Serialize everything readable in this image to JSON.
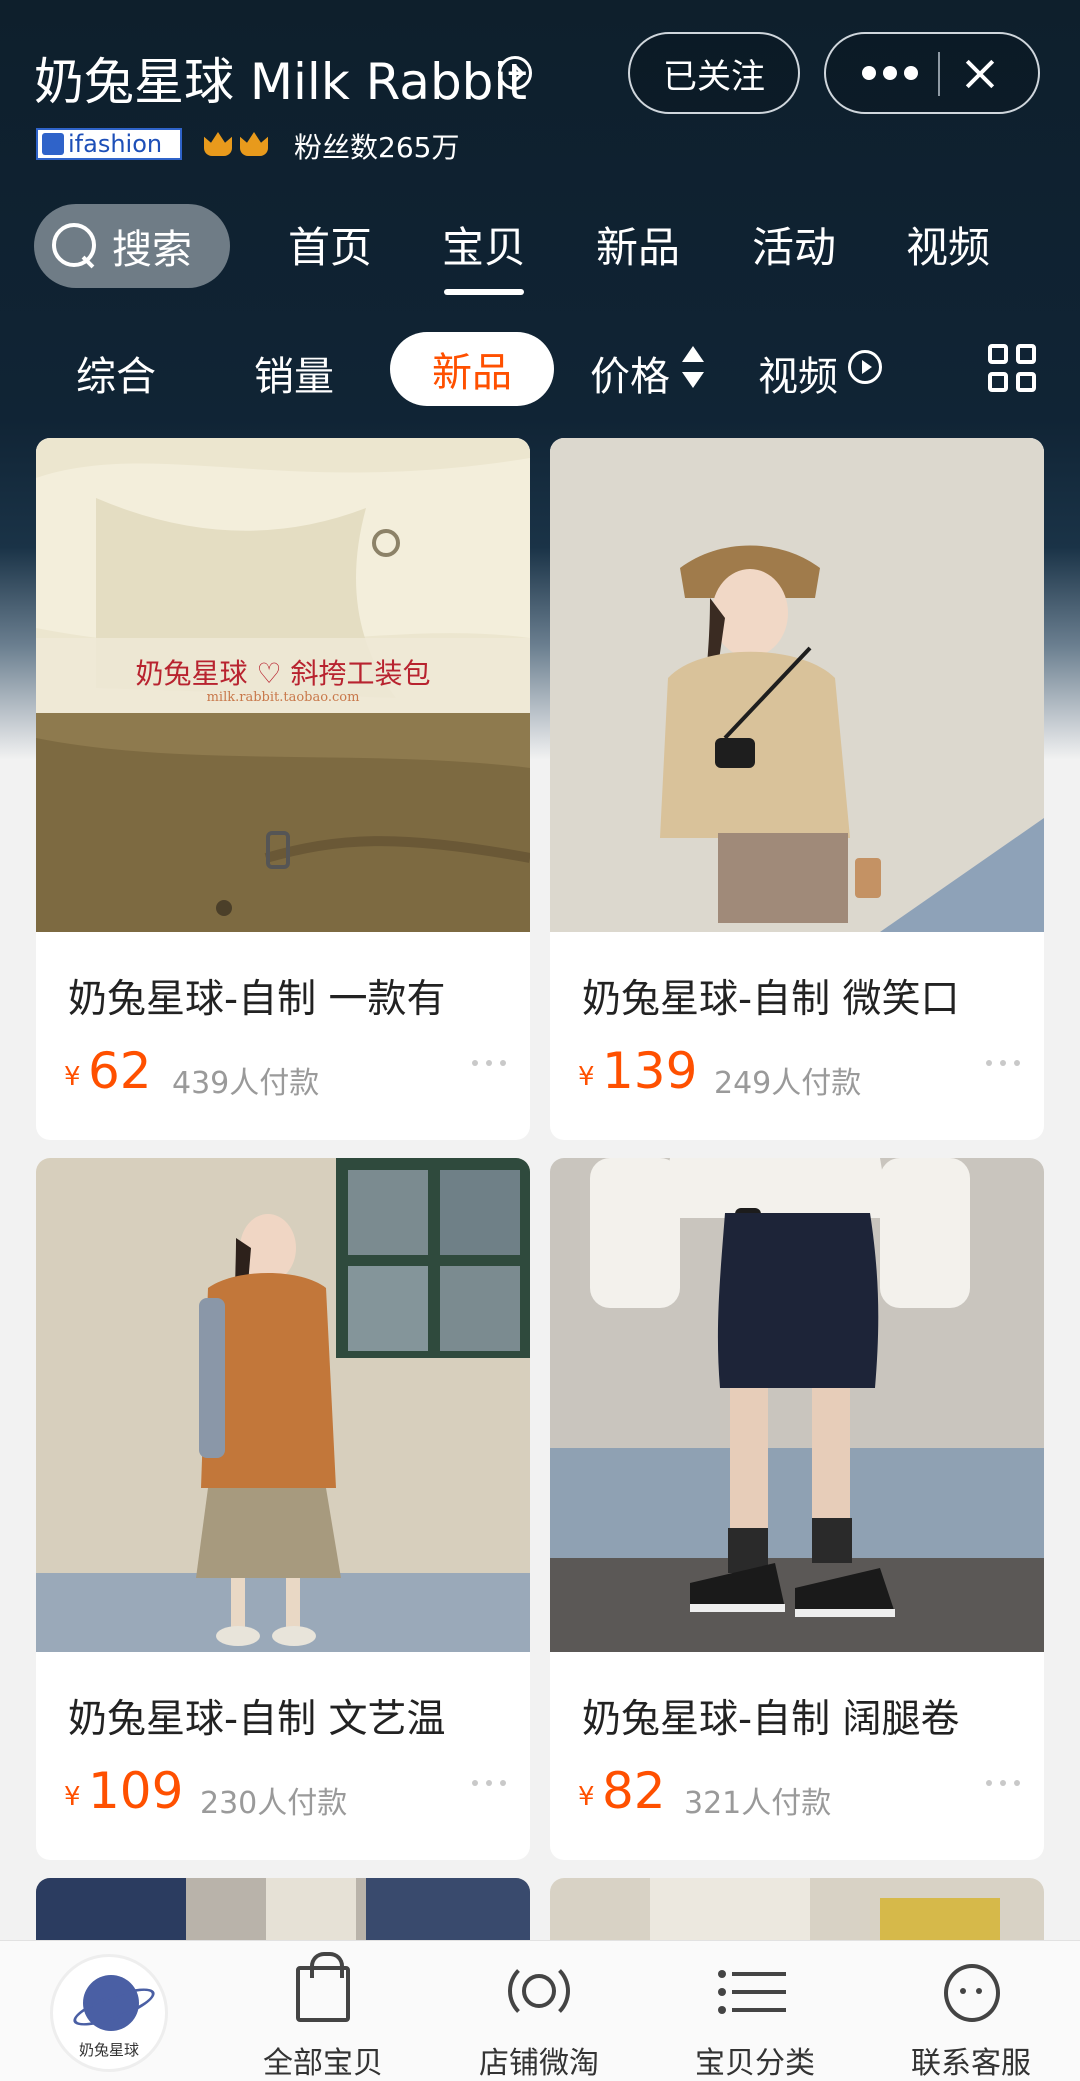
{
  "header": {
    "shop_name": "奶兔星球 Milk Rabbit",
    "follow_label": "已关注",
    "badge_text": "ifashion",
    "fans_text": "粉丝数265万"
  },
  "search": {
    "label": "搜索"
  },
  "tabs": [
    {
      "label": "首页",
      "active": false
    },
    {
      "label": "宝贝",
      "active": true
    },
    {
      "label": "新品",
      "active": false
    },
    {
      "label": "活动",
      "active": false
    },
    {
      "label": "视频",
      "active": false
    }
  ],
  "sort_bar": {
    "items": [
      "综合",
      "销量",
      "新品",
      "价格",
      "视频"
    ],
    "active": "新品"
  },
  "products": [
    {
      "title": "奶兔星球-自制 一款有",
      "currency": "¥",
      "price": "62",
      "sales": "439人付款",
      "image": "olive-canvas-crossbody-bag",
      "img_caption": "奶兔星球 ♡ 斜挎工装包",
      "img_url": "milk.rabbit.taobao.com"
    },
    {
      "title": "奶兔星球-自制 微笑口",
      "currency": "¥",
      "price": "139",
      "sales": "249人付款",
      "image": "beige-corduroy-jacket"
    },
    {
      "title": "奶兔星球-自制 文艺温",
      "currency": "¥",
      "price": "109",
      "sales": "230人付款",
      "image": "orange-shirt-pleated-skirt"
    },
    {
      "title": "奶兔星球-自制 阔腿卷",
      "currency": "¥",
      "price": "82",
      "sales": "321人付款",
      "image": "navy-wide-leg-shorts"
    }
  ],
  "bottom_nav": {
    "logo_text": "奶兔星球",
    "items": [
      {
        "label": "全部宝贝",
        "icon": "bag-icon"
      },
      {
        "label": "店铺微淘",
        "icon": "broadcast-icon"
      },
      {
        "label": "宝贝分类",
        "icon": "list-icon"
      },
      {
        "label": "联系客服",
        "icon": "chat-icon"
      }
    ]
  },
  "colors": {
    "header_bg": "#0e1f2c",
    "accent": "#ff5000",
    "page_bg": "#f2f2f2"
  }
}
